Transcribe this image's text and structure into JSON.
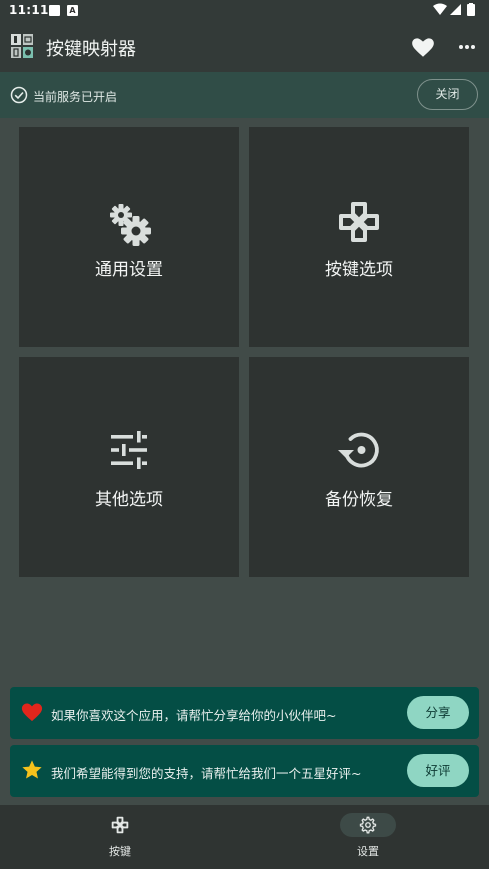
{
  "status_bar": {
    "time": "11:11",
    "notification_icons": [
      "square-icon",
      "a-icon"
    ],
    "right_icons": [
      "wifi-icon",
      "signal-icon",
      "battery-icon"
    ]
  },
  "app_bar": {
    "title": "按键映射器",
    "actions": [
      "heart-icon",
      "more-icon"
    ]
  },
  "service": {
    "text": "当前服务已开启",
    "close_label": "关闭"
  },
  "tiles": [
    {
      "label": "通用设置",
      "icon": "gears-icon"
    },
    {
      "label": "按键选项",
      "icon": "gamepad-icon"
    },
    {
      "label": "其他选项",
      "icon": "sliders-icon"
    },
    {
      "label": "备份恢复",
      "icon": "restore-icon"
    }
  ],
  "promos": [
    {
      "text": "如果你喜欢这个应用，请帮忙分享给你的小伙伴吧~",
      "button": "分享",
      "icon": "red-heart-icon"
    },
    {
      "text": "我们希望能得到您的支持，请帮忙给我们一个五星好评~",
      "button": "好评",
      "icon": "star-icon"
    }
  ],
  "bottom_nav": [
    {
      "label": "按键",
      "icon": "gamepad-icon",
      "selected": false
    },
    {
      "label": "设置",
      "icon": "gear-icon",
      "selected": true
    }
  ],
  "colors": {
    "background": "#414b48",
    "app_bar": "#333a38",
    "service_bar": "#304d47",
    "tile": "#2e3331",
    "promo": "#044e45",
    "promo_button": "#8fd6c3",
    "nav_selected": "#3d4a47"
  }
}
